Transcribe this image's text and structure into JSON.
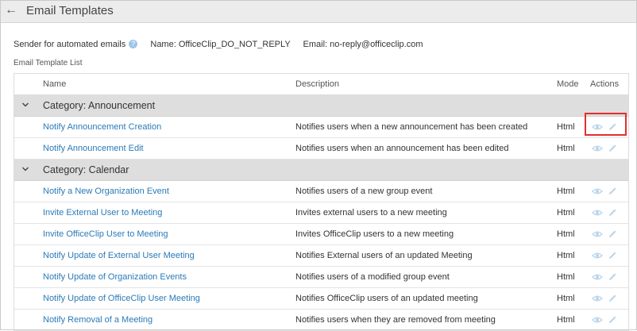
{
  "header": {
    "back_icon": "arrow-left-icon",
    "title": "Email Templates"
  },
  "sender": {
    "label": "Sender for automated emails",
    "help_icon": "?",
    "name_label": "Name:",
    "name_value": "OfficeClip_DO_NOT_REPLY",
    "email_label": "Email:",
    "email_value": "no-reply@officeclip.com"
  },
  "list": {
    "title": "Email Template List",
    "columns": {
      "name": "Name",
      "description": "Description",
      "mode": "Mode",
      "actions": "Actions"
    },
    "categories": [
      {
        "label": "Category: Announcement",
        "rows": [
          {
            "name": "Notify Announcement Creation",
            "description": "Notifies users when a new announcement has been created",
            "mode": "Html"
          },
          {
            "name": "Notify Announcement Edit",
            "description": "Notifies users when an announcement has been edited",
            "mode": "Html"
          }
        ]
      },
      {
        "label": "Category: Calendar",
        "rows": [
          {
            "name": "Notify a New Organization Event",
            "description": "Notifies users of a new group event",
            "mode": "Html"
          },
          {
            "name": "Invite External User to Meeting",
            "description": "Invites external users to a new meeting",
            "mode": "Html"
          },
          {
            "name": "Invite OfficeClip User to Meeting",
            "description": "Invites OfficeClip users to a new meeting",
            "mode": "Html"
          },
          {
            "name": "Notify Update of External User Meeting",
            "description": "Notifies External users of an updated Meeting",
            "mode": "Html"
          },
          {
            "name": "Notify Update of Organization Events",
            "description": "Notifies users of a modified group event",
            "mode": "Html"
          },
          {
            "name": "Notify Update of OfficeClip User Meeting",
            "description": "Notifies OfficeClip users of an updated meeting",
            "mode": "Html"
          },
          {
            "name": "Notify Removal of a Meeting",
            "description": "Notifies users when they are removed from meeting",
            "mode": "Html"
          }
        ]
      }
    ]
  },
  "icons": {
    "expand": "chevron-down-icon",
    "view": "eye-icon",
    "edit": "pencil-icon"
  },
  "colors": {
    "link": "#2a7ab7",
    "category_bg": "#dedede",
    "highlight": "#e0312d",
    "action_icon": "#b9d4ea"
  }
}
